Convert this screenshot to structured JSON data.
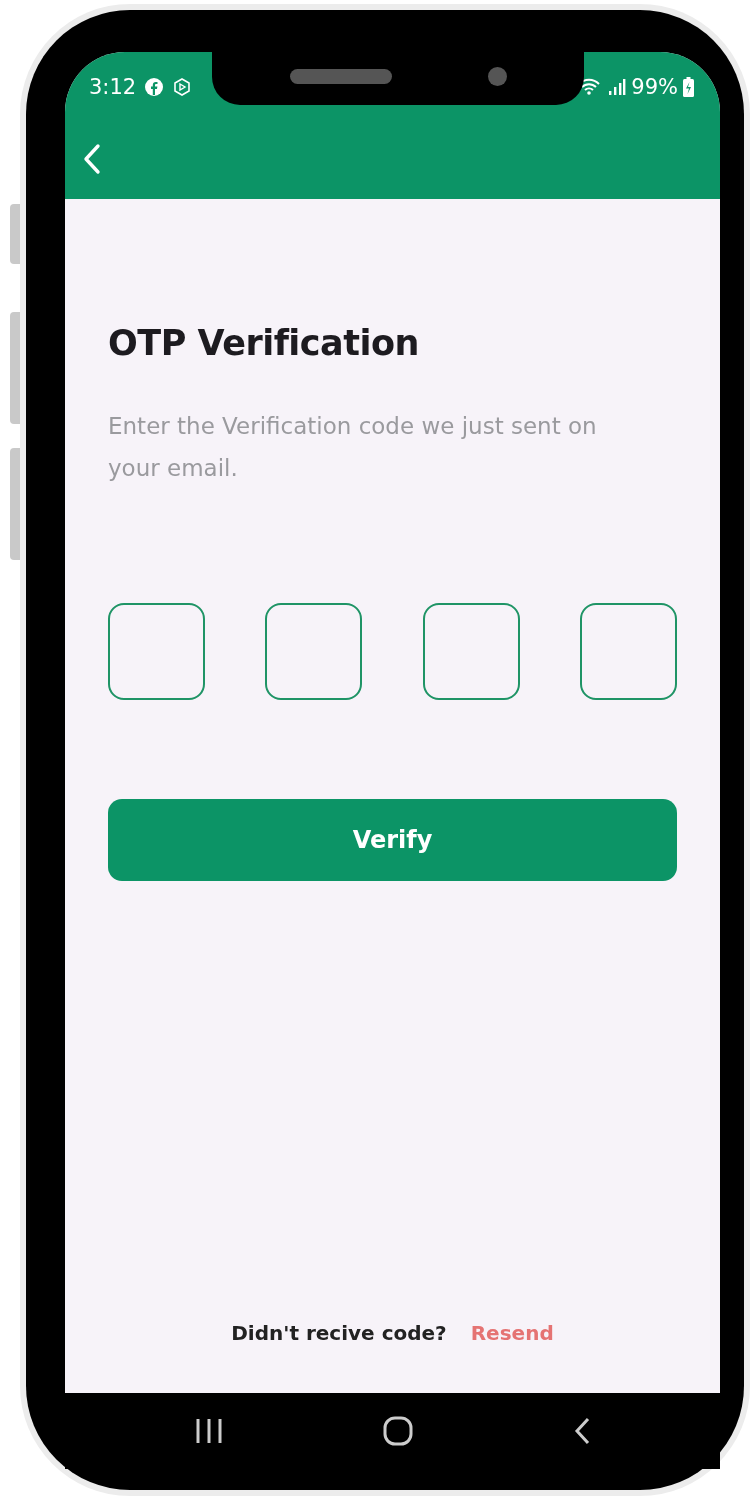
{
  "status_bar": {
    "time": "3:12",
    "battery": "99%"
  },
  "title": "OTP Verification",
  "subtitle": "Enter the Verification code we just sent on your email.",
  "otp_boxes": [
    {
      "filled": false
    },
    {
      "filled": false
    },
    {
      "filled": false
    },
    {
      "filled": false
    }
  ],
  "verify_button": "Verify",
  "footer": {
    "prompt": "Didn't recive code?",
    "link": "Resend"
  }
}
